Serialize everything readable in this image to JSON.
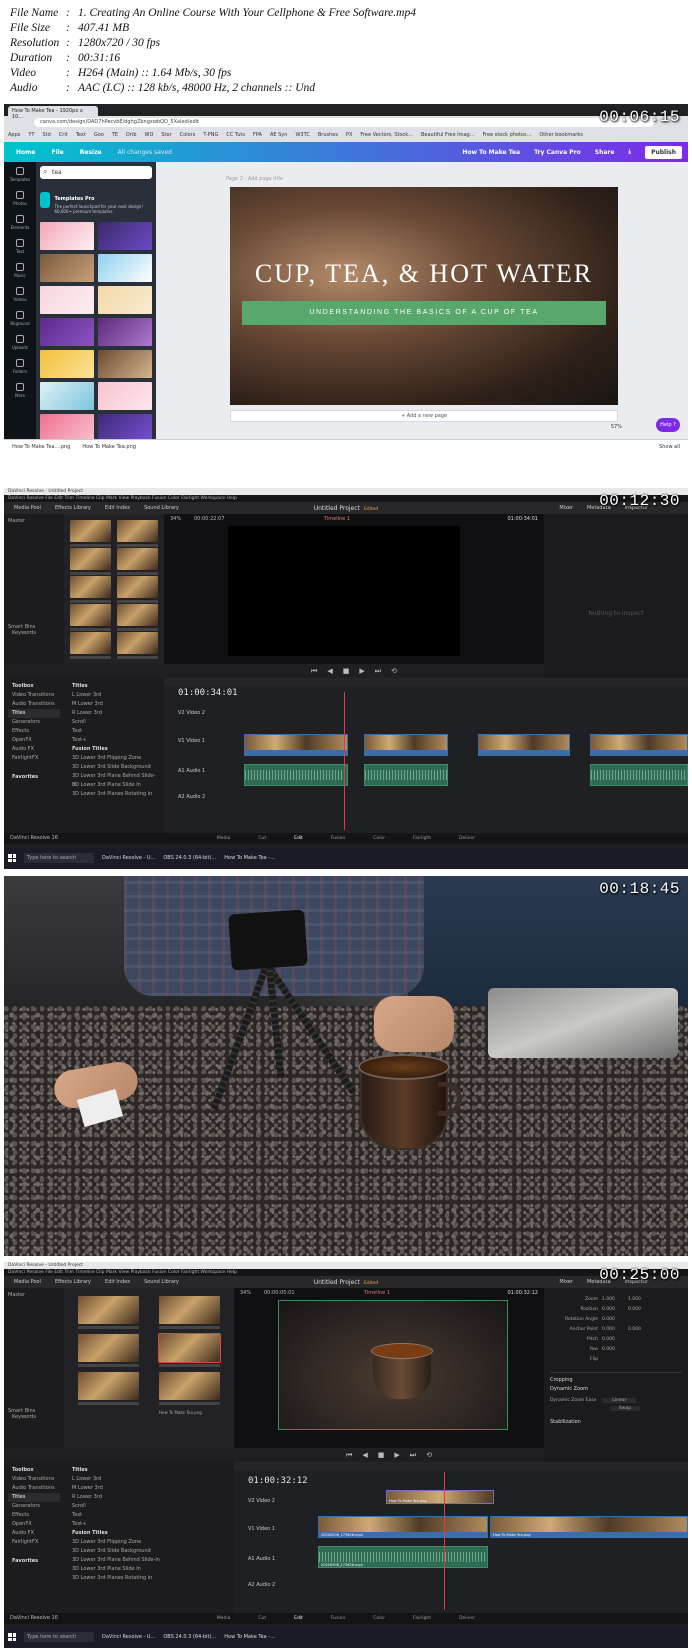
{
  "meta": {
    "rows": [
      {
        "key": "File Name",
        "value": "1. Creating An Online Course With Your Cellphone & Free Software.mp4"
      },
      {
        "key": "File Size",
        "value": "407.41 MB"
      },
      {
        "key": "Resolution",
        "value": "1280x720 / 30 fps"
      },
      {
        "key": "Duration",
        "value": "00:31:16"
      },
      {
        "key": "Video",
        "value": "H264 (Main) :: 1.64 Mb/s, 30 fps"
      },
      {
        "key": "Audio",
        "value": "AAC (LC) :: 128 kb/s, 48000 Hz, 2 channels :: Und"
      }
    ]
  },
  "frames": [
    {
      "timestamp": "00:06:15"
    },
    {
      "timestamp": "00:12:30"
    },
    {
      "timestamp": "00:18:45"
    },
    {
      "timestamp": "00:25:00"
    }
  ],
  "canva": {
    "tab_title": "How To Make Tea - 1920px x 10...",
    "address": "canva.com/design/DAD7hPecvbE/dghgZbngxwbQD_5Xaled/edit",
    "bookmarks": [
      "Apps",
      "YT",
      "Std",
      "Crit",
      "Text",
      "Goo",
      "TE",
      "Drib",
      "WO",
      "Stor",
      "Colors",
      "T-PNG",
      "CC Tuts",
      "FPA",
      "AE Syn",
      "W3TC",
      "Brushes",
      "PX",
      "Free Vectors, Stock...",
      "Beautiful Free Imag...",
      "Free stock photos...",
      "Other bookmarks"
    ],
    "nav": {
      "home": "Home",
      "file": "File",
      "resize": "Resize",
      "saved": "All changes saved"
    },
    "actions": {
      "title": "How To Make Tea",
      "try_pro": "Try Canva Pro",
      "share": "Share",
      "publish": "Publish"
    },
    "rail": [
      "Templates",
      "Photos",
      "Elements",
      "Text",
      "Music",
      "Videos",
      "Bkground",
      "Uploads",
      "Folders",
      "More"
    ],
    "search_value": "tea",
    "templates_pro_title": "Templates Pro",
    "templates_pro_desc": "The perfect launchpad for your next design! 60,000+ premium templates.",
    "page_label": "Page 2 - Add page title",
    "design_title": "CUP, TEA, & HOT WATER",
    "design_subtitle": "UNDERSTANDING THE BASICS OF A CUP OF TEA",
    "add_page": "+ Add a new page",
    "zoom": "57%",
    "help": "Help ?",
    "downloads": [
      "How To Make Tea....png",
      "How To Make Tea.png"
    ],
    "show_all": "Show all"
  },
  "resolve1": {
    "title": "DaVinci Resolve - Untitled Project",
    "menu": "DaVinci Resolve  File  Edit  Trim  Timeline  Clip  Mark  View  Playback  Fusion  Color  Fairlight  Workspace  Help",
    "toolbar": {
      "media_pool": "Media Pool",
      "effects": "Effects Library",
      "edit_index": "Edit Index",
      "sound": "Sound Library",
      "mixer": "Mixer",
      "metadata": "Metadata",
      "inspector": "Inspector"
    },
    "project": "Untitled Project",
    "edited": "Edited",
    "timeline_name": "Timeline 1",
    "zoom": "34%",
    "source_tc": "00:00:22:07",
    "program_tc": "01:00:34:01",
    "master": "Master",
    "smart_bins": "Smart Bins",
    "keywords": "Keywords",
    "inspect_empty": "Nothing to inspect",
    "timecode": "01:00:34:01",
    "tracks": [
      "V2  Video 2",
      "V1  Video 1",
      "A1  Audio 1",
      "A2  Audio 2"
    ],
    "fx_tree": [
      "Toolbox",
      "Video Transitions",
      "Audio Transitions",
      "Titles",
      "Generators",
      "Effects",
      "OpenFX",
      "Audio FX",
      "FairlightFX",
      "Favorites"
    ],
    "titles_list": [
      "Titles",
      "L Lower 3rd",
      "M Lower 3rd",
      "R Lower 3rd",
      "Scroll",
      "Text",
      "Text+",
      "Fusion Titles",
      "3D Lower 3rd Flipping Zone",
      "3D Lower 3rd Slide Background",
      "3D Lower 3rd Plane Behind Slide-In",
      "3D Lower 3rd Plane Slide In",
      "3D Lower 3rd Planes Rotating In"
    ],
    "pages": [
      "Media",
      "Cut",
      "Edit",
      "Fusion",
      "Color",
      "Fairlight",
      "Deliver"
    ],
    "app_name": "DaVinci Resolve 16",
    "taskbar_search": "Type here to search",
    "taskbar_items": [
      "DaVinci Resolve - U...",
      "OBS 24.0.3 (64-bit)...",
      "How To Make Tea -..."
    ]
  },
  "resolve2": {
    "project": "Untitled Project",
    "edited": "Edited",
    "timeline_name": "Timeline 1",
    "zoom": "34%",
    "source_tc": "00:00:05:01",
    "program_tc": "01:00:32:12",
    "timecode": "01:00:32:12",
    "thumb_label": "How To Make Tea.png",
    "inspector_rows": [
      {
        "label": "Zoom",
        "x": "1.000",
        "y": "1.000"
      },
      {
        "label": "Position",
        "x": "0.000",
        "y": "0.000"
      },
      {
        "label": "Rotation Angle",
        "x": "0.000",
        "y": ""
      },
      {
        "label": "Anchor Point",
        "x": "0.000",
        "y": "0.000"
      },
      {
        "label": "Pitch",
        "x": "0.000",
        "y": ""
      },
      {
        "label": "Yaw",
        "x": "0.000",
        "y": ""
      },
      {
        "label": "Flip",
        "x": "",
        "y": ""
      }
    ],
    "inspector_sections": [
      "Cropping",
      "Dynamic Zoom",
      "Stabilization"
    ],
    "dz_ease_label": "Dynamic Zoom Ease",
    "dz_ease_value": "Linear",
    "dz_swap": "Swap",
    "title_clip": "How To Make Tea.png",
    "video_clip_a": "20200506_173626.mp4",
    "video_clip_b": "How To Make Tea.png",
    "audio_clip": "20200506_173626.mp4"
  }
}
